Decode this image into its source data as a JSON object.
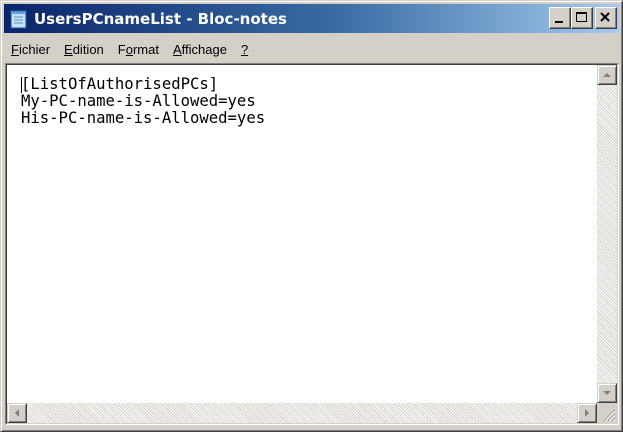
{
  "window": {
    "title": "UsersPCnameList - Bloc-notes",
    "app_icon": "notepad-icon"
  },
  "title_buttons": {
    "minimize_icon": "minimize-icon",
    "maximize_icon": "maximize-icon",
    "close_icon": "close-icon"
  },
  "menu": {
    "items": [
      {
        "mnemonic": "F",
        "rest": "ichier"
      },
      {
        "mnemonic": "E",
        "rest": "dition"
      },
      {
        "before": "F",
        "mnemonic": "o",
        "rest": "rmat"
      },
      {
        "mnemonic": "A",
        "rest": "ffichage"
      },
      {
        "mnemonic": "?",
        "rest": ""
      }
    ]
  },
  "editor": {
    "content": "[ListOfAuthorisedPCs]\nMy-PC-name-is-Allowed=yes\nHis-PC-name-is-Allowed=yes"
  },
  "scrollbars": {
    "up_icon": "scroll-up-arrow-icon",
    "down_icon": "scroll-down-arrow-icon",
    "left_icon": "scroll-left-arrow-icon",
    "right_icon": "scroll-right-arrow-icon",
    "grip_icon": "size-grip-icon"
  },
  "colors": {
    "title_start": "#0a246a",
    "title_end": "#a6caf0",
    "face": "#d4d0c8"
  }
}
